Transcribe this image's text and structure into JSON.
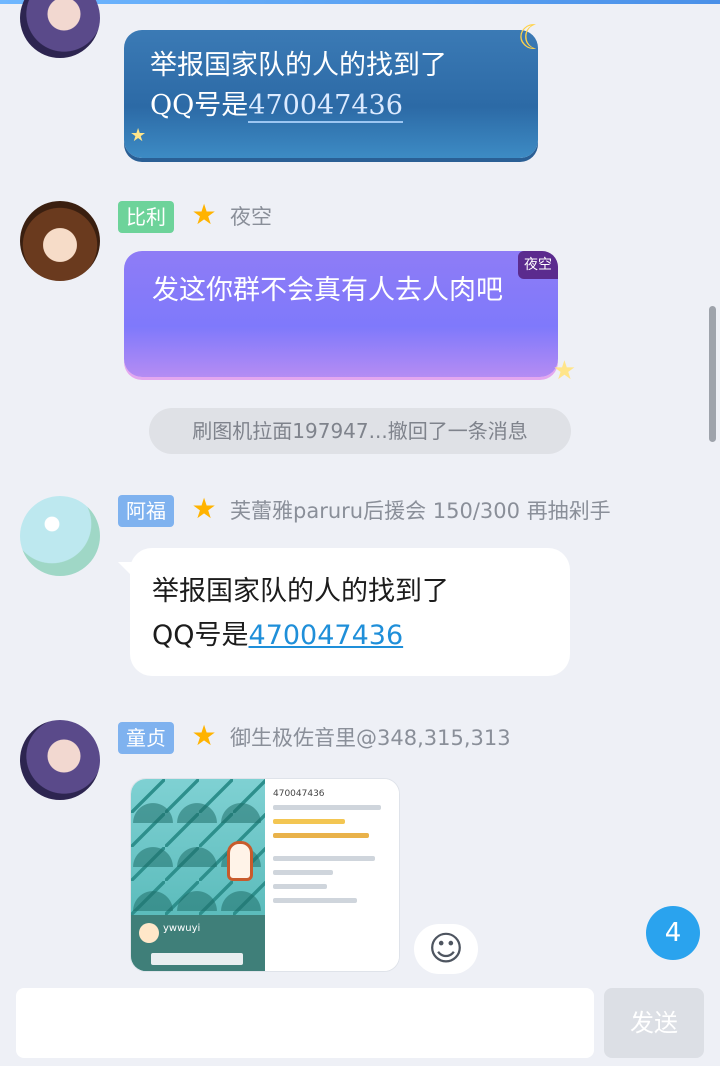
{
  "messages": [
    {
      "tag": "童贞",
      "nickname": "御生极佐音里@348,315,313",
      "text_line1": "举报国家队的人的找到了",
      "text_prefix": "QQ号是",
      "text_link": "470047436"
    },
    {
      "tag": "比利",
      "nickname": "夜空",
      "text": "发这你群不会真有人去人肉吧",
      "corner_tag": "夜空"
    },
    {
      "tag": "阿福",
      "nickname": "芙蕾雅paruru后援会 150/300 再抽剁手",
      "text_line1": "举报国家队的人的找到了",
      "text_prefix": "QQ号是",
      "text_link": "470047436"
    },
    {
      "tag": "童贞",
      "nickname": "御生极佐音里@348,315,313",
      "image_card": {
        "qq_number": "470047436",
        "username": "ywwuyi"
      }
    }
  ],
  "recall_notice": "刷图机拉面197947...撤回了一条消息",
  "unread_count": "4",
  "input": {
    "placeholder": "",
    "send_label": "发送"
  },
  "icons": {
    "emoji": "emoji-add-icon",
    "star": "star-icon",
    "moon": "moon-icon"
  },
  "colors": {
    "accent": "#2aa3ee",
    "link": "#1f8fd9",
    "tag_blue": "#7fb2ef",
    "tag_green": "#6dd39a"
  }
}
